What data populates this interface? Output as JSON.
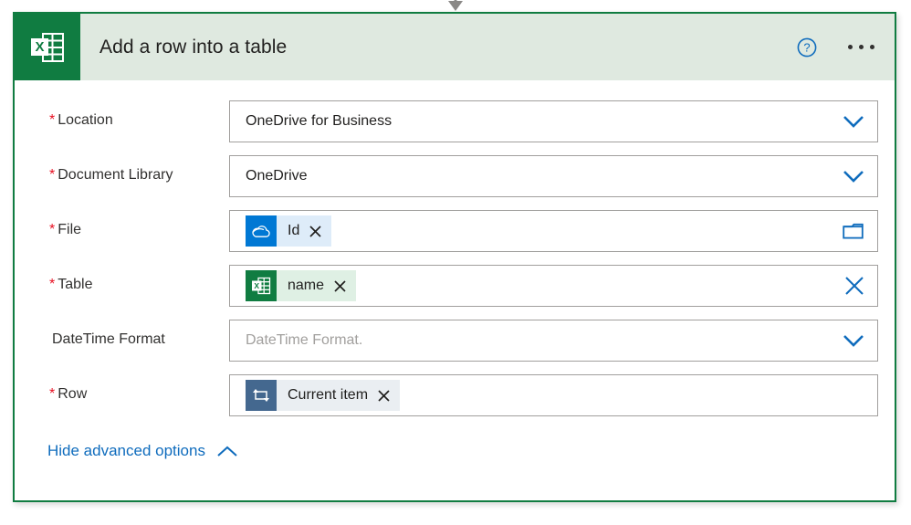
{
  "connector": {
    "arrow_icon": "arrow-down-icon"
  },
  "card": {
    "accent_color": "#107c41",
    "header": {
      "app_icon": "excel-icon",
      "title": "Add a row into a table",
      "help_icon": "help-circle-icon",
      "menu_icon": "ellipsis-icon"
    },
    "fields": [
      {
        "key": "location",
        "label": "Location",
        "required": true,
        "required_marker": "*",
        "control": "dropdown",
        "value": "OneDrive for Business",
        "trailing_icon": "chevron-down-icon"
      },
      {
        "key": "document_library",
        "label": "Document Library",
        "required": true,
        "required_marker": "*",
        "control": "dropdown",
        "value": "OneDrive",
        "trailing_icon": "chevron-down-icon"
      },
      {
        "key": "file",
        "label": "File",
        "required": true,
        "required_marker": "*",
        "control": "token",
        "token": {
          "icon": "onedrive-cloud-icon",
          "icon_style": "onedrive",
          "text": "Id",
          "remove_icon": "close-icon"
        },
        "trailing_icon": "folder-icon"
      },
      {
        "key": "table",
        "label": "Table",
        "required": true,
        "required_marker": "*",
        "control": "token",
        "token": {
          "icon": "excel-icon",
          "icon_style": "excel",
          "text": "name",
          "remove_icon": "close-icon"
        },
        "trailing_icon": "clear-x-icon"
      },
      {
        "key": "datetime_format",
        "label": "DateTime Format",
        "required": false,
        "required_marker": "",
        "control": "dropdown",
        "placeholder": "DateTime Format.",
        "value": "",
        "trailing_icon": "chevron-down-icon"
      },
      {
        "key": "row",
        "label": "Row",
        "required": true,
        "required_marker": "*",
        "control": "token",
        "token": {
          "icon": "apply-to-each-loop-icon",
          "icon_style": "loop",
          "text": "Current item",
          "remove_icon": "close-icon"
        },
        "trailing_icon": ""
      }
    ],
    "footer": {
      "advanced_label": "Hide advanced options",
      "advanced_icon": "chevron-up-icon"
    }
  },
  "colors": {
    "excel_green": "#107c41",
    "header_bg": "#dfe9e0",
    "link_blue": "#0f6cbd",
    "accent_blue": "#0078d4",
    "required_red": "#e81123",
    "loop_slate": "#44688f"
  }
}
